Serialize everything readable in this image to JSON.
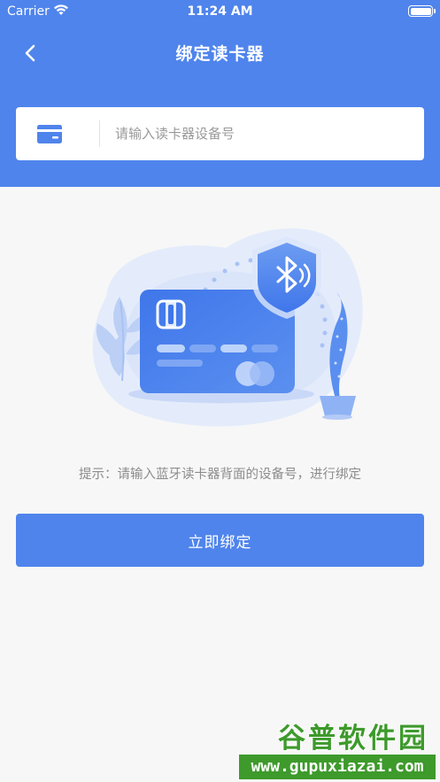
{
  "status_bar": {
    "carrier": "Carrier",
    "time": "11:24 AM",
    "battery_level": 1.0
  },
  "header": {
    "title": "绑定读卡器",
    "back_icon": "chevron-left-icon"
  },
  "device_input": {
    "icon": "card-icon",
    "placeholder": "请输入读卡器设备号",
    "value": ""
  },
  "hint": "提示：请输入蓝牙读卡器背面的设备号，进行绑定",
  "bind_button": {
    "label": "立即绑定"
  },
  "watermark": {
    "brand": "谷普软件园",
    "url": "www.gupuxiazai.com"
  },
  "colors": {
    "primary": "#4f84ec",
    "background": "#f7f7f7",
    "watermark": "#3d9a2b"
  }
}
